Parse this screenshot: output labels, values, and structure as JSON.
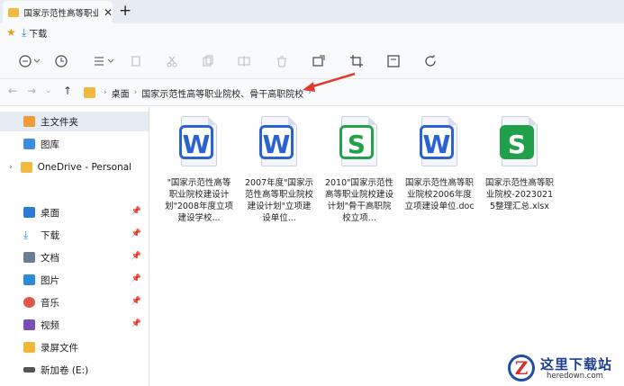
{
  "tab": {
    "title": "国家示范性高等职业",
    "close": "✕",
    "new": "+"
  },
  "quick": {
    "download_label": "下载"
  },
  "address": {
    "crumbs": [
      "桌面",
      "国家示范性高等职业院校、骨干高职院校"
    ],
    "sep": "›"
  },
  "sidebar": {
    "main_home": "主文件夹",
    "gallery": "图库",
    "onedrive": "OneDrive - Personal",
    "items": [
      {
        "label": "桌面",
        "color": "#2b7bd6"
      },
      {
        "label": "下载",
        "color": "#2a8bd7"
      },
      {
        "label": "文档",
        "color": "#6a7d95"
      },
      {
        "label": "图片",
        "color": "#2f8ad6"
      },
      {
        "label": "音乐",
        "color": "#e0584a"
      },
      {
        "label": "视频",
        "color": "#7a4fb5"
      },
      {
        "label": "录屏文件",
        "color": "#f0b73a"
      },
      {
        "label": "新加卷 (E:)",
        "color": "#555555"
      }
    ]
  },
  "files": [
    {
      "type": "W",
      "name": "\"国家示范性高等职业院校建设计划\"2008年度立项建设学校..."
    },
    {
      "type": "W",
      "name": "2007年度\"国家示范性高等职业院校建设计划\"立项建设单位..."
    },
    {
      "type": "S",
      "name": "2010\"国家示范性高等职业院校建设计划\"骨干高职院校立项..."
    },
    {
      "type": "W",
      "name": "国家示范性高等职业院校2006年度立项建设单位.doc"
    },
    {
      "type": "SF",
      "name": "国家示范性高等职业院校-20230215整理汇总.xlsx"
    }
  ],
  "watermark": {
    "logo": "Z",
    "title": "这里下载站",
    "url": "heredown.com"
  }
}
